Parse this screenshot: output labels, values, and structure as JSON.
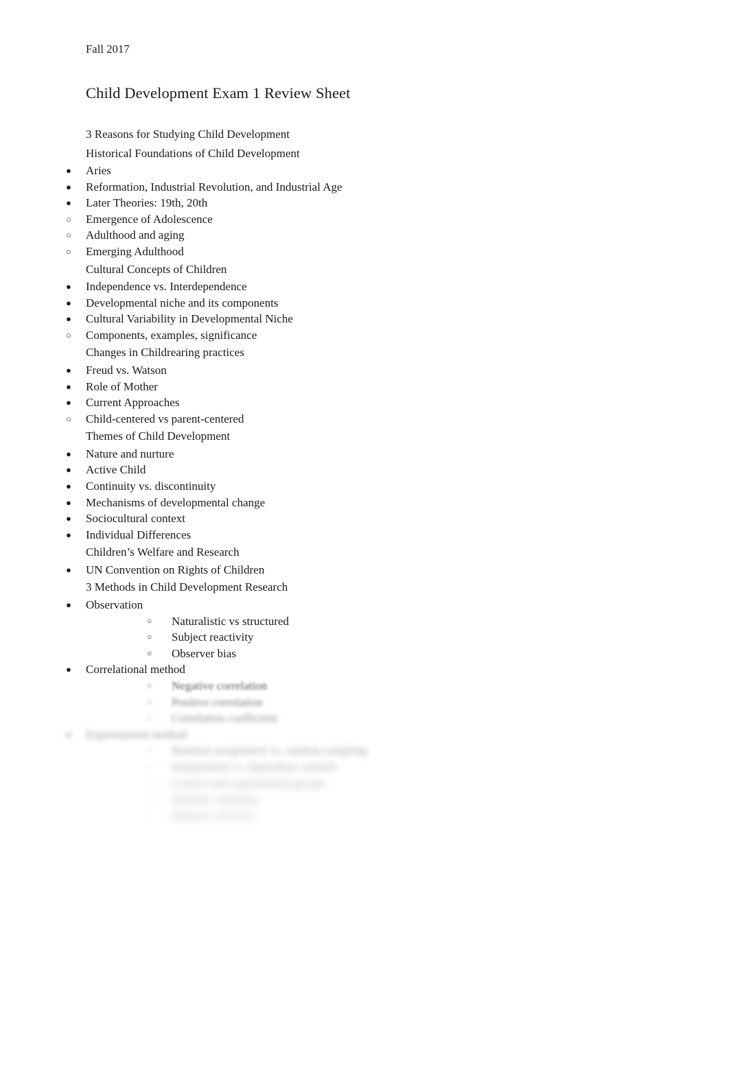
{
  "document": {
    "date": "Fall 2017",
    "title": "Child Development Exam 1 Review Sheet"
  },
  "outline": [
    {
      "kind": "section",
      "level": 0,
      "bullet": "none",
      "text": "3 Reasons for Studying Child Development",
      "blur": 0
    },
    {
      "kind": "section",
      "level": 0,
      "bullet": "none",
      "text": "Historical Foundations of Child Development",
      "blur": 0
    },
    {
      "kind": "item",
      "level": 1,
      "bullet": "filled",
      "text": "Aries",
      "blur": 0
    },
    {
      "kind": "item",
      "level": 1,
      "bullet": "filled",
      "text": "Reformation, Industrial Revolution, and Industrial Age",
      "blur": 0
    },
    {
      "kind": "item",
      "level": 1,
      "bullet": "filled",
      "text": "Later Theories: 19th, 20th",
      "blur": 0
    },
    {
      "kind": "item",
      "level": 1,
      "bullet": "hollow",
      "text": "Emergence of Adolescence",
      "blur": 0
    },
    {
      "kind": "item",
      "level": 1,
      "bullet": "hollow",
      "text": "Adulthood and aging",
      "blur": 0
    },
    {
      "kind": "item",
      "level": 1,
      "bullet": "hollow",
      "text": "Emerging Adulthood",
      "blur": 0
    },
    {
      "kind": "section",
      "level": 0,
      "bullet": "none",
      "text": "Cultural Concepts of Children",
      "blur": 0
    },
    {
      "kind": "item",
      "level": 1,
      "bullet": "filled",
      "text": "Independence vs. Interdependence",
      "blur": 0
    },
    {
      "kind": "item",
      "level": 1,
      "bullet": "filled",
      "text": "Developmental niche and its components",
      "blur": 0
    },
    {
      "kind": "item",
      "level": 1,
      "bullet": "filled",
      "text": "Cultural Variability in Developmental Niche",
      "blur": 0
    },
    {
      "kind": "item",
      "level": 1,
      "bullet": "hollow",
      "text": "Components, examples, significance",
      "blur": 0
    },
    {
      "kind": "section",
      "level": 0,
      "bullet": "none",
      "text": "Changes in Childrearing practices",
      "blur": 0
    },
    {
      "kind": "item",
      "level": 1,
      "bullet": "filled",
      "text": "Freud vs. Watson",
      "blur": 0
    },
    {
      "kind": "item",
      "level": 1,
      "bullet": "filled",
      "text": "Role of Mother",
      "blur": 0
    },
    {
      "kind": "item",
      "level": 1,
      "bullet": "filled",
      "text": "Current Approaches",
      "blur": 0
    },
    {
      "kind": "item",
      "level": 1,
      "bullet": "hollow",
      "text": "Child-centered vs parent-centered",
      "blur": 0
    },
    {
      "kind": "section",
      "level": 0,
      "bullet": "none",
      "text": "Themes of Child Development",
      "blur": 0
    },
    {
      "kind": "item",
      "level": 1,
      "bullet": "filled",
      "text": "Nature and nurture",
      "blur": 0
    },
    {
      "kind": "item",
      "level": 1,
      "bullet": "filled",
      "text": "Active Child",
      "blur": 0
    },
    {
      "kind": "item",
      "level": 1,
      "bullet": "filled",
      "text": "Continuity vs. discontinuity",
      "blur": 0
    },
    {
      "kind": "item",
      "level": 1,
      "bullet": "filled",
      "text": "Mechanisms of developmental change",
      "blur": 0
    },
    {
      "kind": "item",
      "level": 1,
      "bullet": "filled",
      "text": "Sociocultural context",
      "blur": 0
    },
    {
      "kind": "item",
      "level": 1,
      "bullet": "filled",
      "text": "Individual Differences",
      "blur": 0
    },
    {
      "kind": "section",
      "level": 0,
      "bullet": "none",
      "text": "Children’s Welfare and Research",
      "blur": 0
    },
    {
      "kind": "item",
      "level": 1,
      "bullet": "filled",
      "text": "UN Convention on Rights of Children",
      "blur": 0
    },
    {
      "kind": "section",
      "level": 0,
      "bullet": "none",
      "text": "3 Methods in Child Development Research",
      "blur": 0
    },
    {
      "kind": "item",
      "level": 1,
      "bullet": "filled",
      "text": "Observation",
      "blur": 0
    },
    {
      "kind": "item",
      "level": 2,
      "bullet": "hollow",
      "text": "Naturalistic vs structured",
      "blur": 0
    },
    {
      "kind": "item",
      "level": 2,
      "bullet": "hollow",
      "text": "Subject reactivity",
      "blur": 0
    },
    {
      "kind": "item",
      "level": 2,
      "bullet": "hollow",
      "text": "Observer bias",
      "blur": 0
    },
    {
      "kind": "item",
      "level": 1,
      "bullet": "filled",
      "text": "Correlational method",
      "blur": 0
    },
    {
      "kind": "item",
      "level": 2,
      "bullet": "hollow",
      "text": "Negative correlation",
      "blur": 1,
      "bullet_sharp": true
    },
    {
      "kind": "item",
      "level": 2,
      "bullet": "hollow",
      "text": "Positive correlation",
      "blur": 2
    },
    {
      "kind": "item",
      "level": 2,
      "bullet": "hollow",
      "text": "Correlation coefficient",
      "blur": 3
    },
    {
      "kind": "item",
      "level": 1,
      "bullet": "filled",
      "text": "Experimental method",
      "blur": 4
    },
    {
      "kind": "item",
      "level": 2,
      "bullet": "hollow",
      "text": "Random assignment vs. random sampling",
      "blur": 5
    },
    {
      "kind": "item",
      "level": 2,
      "bullet": "hollow",
      "text": "Independent vs. dependent variable",
      "blur": 6
    },
    {
      "kind": "item",
      "level": 2,
      "bullet": "hollow",
      "text": "Control and experimental groups",
      "blur": 7
    },
    {
      "kind": "item",
      "level": 2,
      "bullet": "hollow",
      "text": "Random sampling",
      "blur": 8
    },
    {
      "kind": "item",
      "level": 2,
      "bullet": "hollow",
      "text": "Random selection",
      "blur": 9
    }
  ]
}
